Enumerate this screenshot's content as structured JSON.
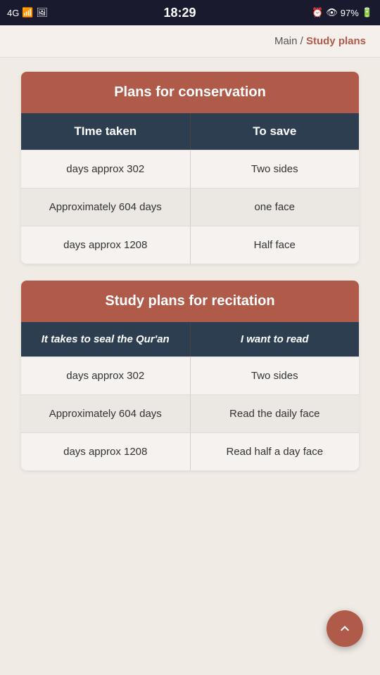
{
  "statusBar": {
    "time": "18:29",
    "battery": "97%",
    "network": "4G"
  },
  "breadcrumb": {
    "main": "Main",
    "separator": "/",
    "current": "Study plans"
  },
  "conservationSection": {
    "title": "Plans for conservation",
    "headers": {
      "col1": "TIme taken",
      "col2": "To save"
    },
    "rows": [
      {
        "col1": "days approx 302",
        "col2": "Two sides"
      },
      {
        "col1": "Approximately 604 days",
        "col2": "one face"
      },
      {
        "col1": "days approx 1208",
        "col2": "Half face"
      }
    ]
  },
  "recitationSection": {
    "title": "Study plans for recitation",
    "headers": {
      "col1": "It takes to seal the Qur'an",
      "col2": "I want to read"
    },
    "rows": [
      {
        "col1": "days approx 302",
        "col2": "Two sides"
      },
      {
        "col1": "Approximately 604 days",
        "col2": "Read the daily face"
      },
      {
        "col1": "days approx 1208",
        "col2": "Read half a day face"
      }
    ]
  },
  "scrollTopLabel": "↑"
}
